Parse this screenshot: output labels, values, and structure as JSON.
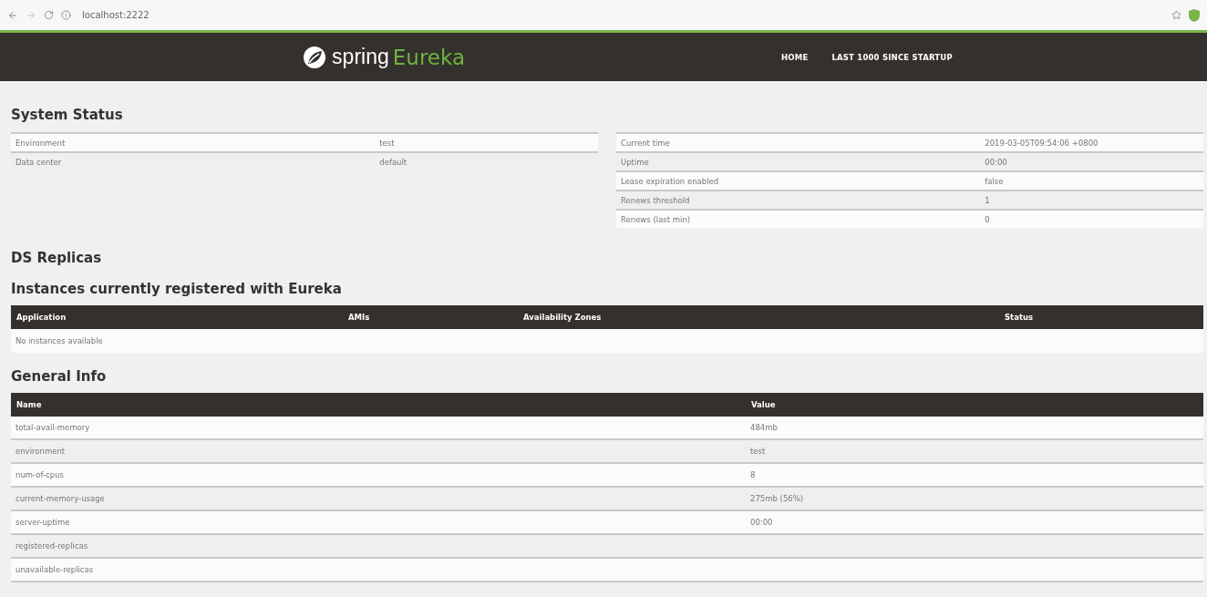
{
  "browser": {
    "address": "localhost:2222"
  },
  "header": {
    "brand": "spring",
    "product": "Eureka",
    "nav": [
      {
        "label": "HOME"
      },
      {
        "label": "LAST 1000 SINCE STARTUP"
      }
    ]
  },
  "system_status": {
    "title": "System Status",
    "left": [
      {
        "name": "Environment",
        "value": "test"
      },
      {
        "name": "Data center",
        "value": "default"
      }
    ],
    "right": [
      {
        "name": "Current time",
        "value": "2019-03-05T09:54:06 +0800"
      },
      {
        "name": "Uptime",
        "value": "00:00"
      },
      {
        "name": "Lease expiration enabled",
        "value": "false"
      },
      {
        "name": "Renews threshold",
        "value": "1"
      },
      {
        "name": "Renews (last min)",
        "value": "0"
      }
    ]
  },
  "ds_replicas": {
    "title": "DS Replicas"
  },
  "instances": {
    "title": "Instances currently registered with Eureka",
    "columns": [
      "Application",
      "AMIs",
      "Availability Zones",
      "Status"
    ],
    "empty_message": "No instances available"
  },
  "general_info": {
    "title": "General Info",
    "columns": [
      "Name",
      "Value"
    ],
    "rows": [
      {
        "name": "total-avail-memory",
        "value": "484mb"
      },
      {
        "name": "environment",
        "value": "test"
      },
      {
        "name": "num-of-cpus",
        "value": "8"
      },
      {
        "name": "current-memory-usage",
        "value": "275mb (56%)"
      },
      {
        "name": "server-uptime",
        "value": "00:00"
      },
      {
        "name": "registered-replicas",
        "value": ""
      },
      {
        "name": "unavailable-replicas",
        "value": ""
      }
    ]
  }
}
